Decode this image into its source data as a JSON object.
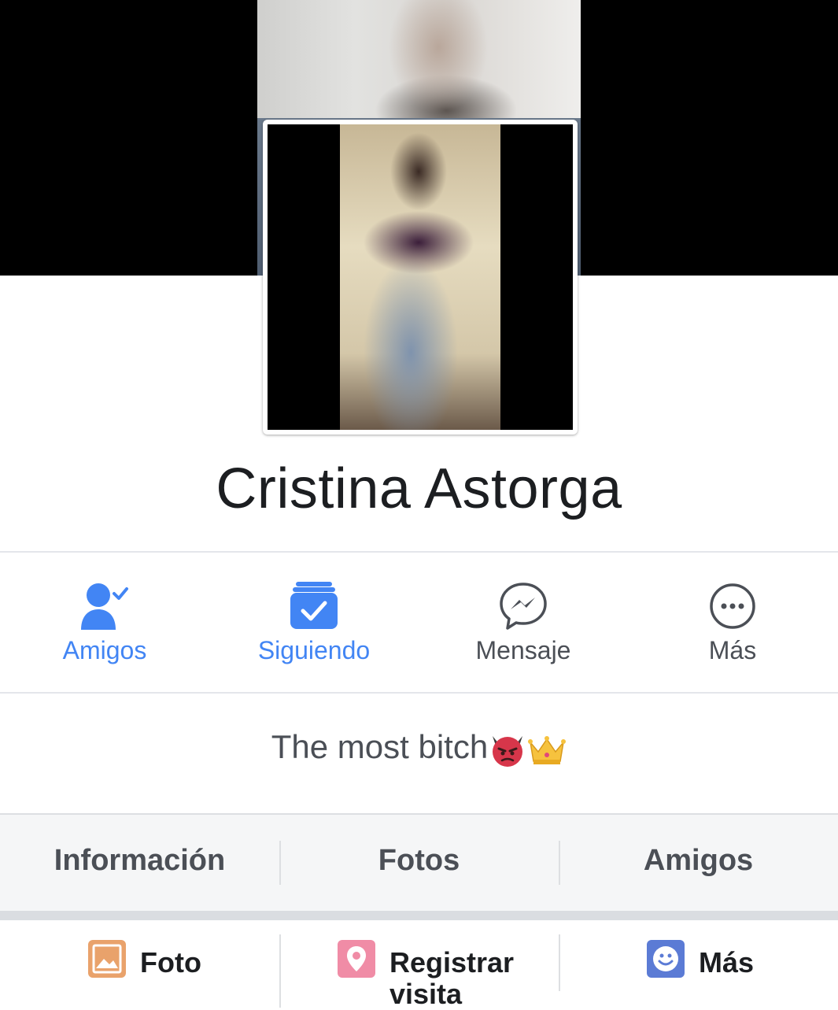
{
  "profile": {
    "name": "Cristina Astorga",
    "bio_text": "The most bitch",
    "bio_emojis": [
      "angry-devil-emoji",
      "crown-emoji"
    ]
  },
  "actions": [
    {
      "label": "Amigos",
      "icon": "friends-check-icon",
      "active": true
    },
    {
      "label": "Siguiendo",
      "icon": "following-inbox-icon",
      "active": true
    },
    {
      "label": "Mensaje",
      "icon": "messenger-icon",
      "active": false
    },
    {
      "label": "Más",
      "icon": "more-dots-icon",
      "active": false
    }
  ],
  "tabs": [
    "Información",
    "Fotos",
    "Amigos"
  ],
  "composer": [
    {
      "label": "Foto",
      "icon": "photo-icon",
      "color": "#e9a26b"
    },
    {
      "label": "Registrar visita",
      "icon": "location-pin-icon",
      "color": "#f08ca6"
    },
    {
      "label": "Más",
      "icon": "smiley-icon",
      "color": "#5b7bd5"
    }
  ],
  "colors": {
    "accent": "#4285f4",
    "text_secondary": "#4b4f56"
  }
}
